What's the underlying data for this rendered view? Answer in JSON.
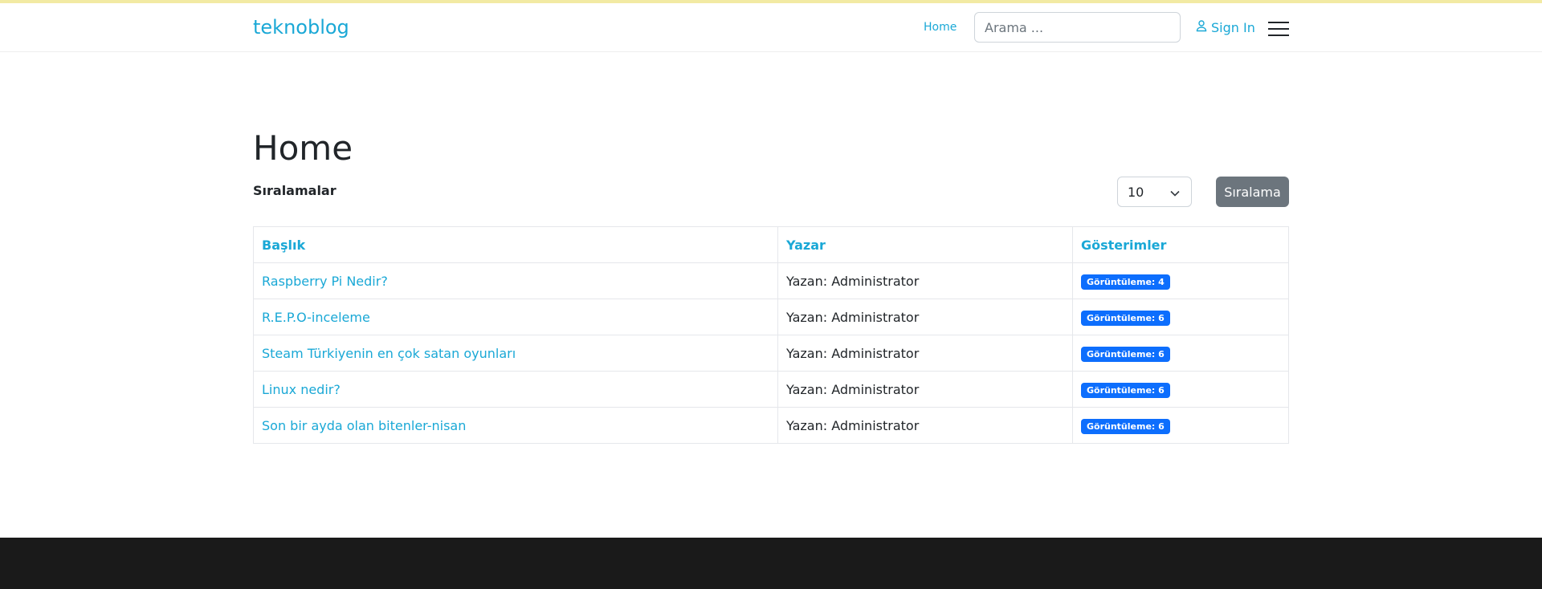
{
  "header": {
    "brand": "teknoblog",
    "nav_home": "Home",
    "search_placeholder": "Arama ...",
    "signin": "Sign In"
  },
  "main": {
    "title": "Home",
    "section_label": "Sıralamalar",
    "per_page_value": "10",
    "sort_button": "Sıralama"
  },
  "table": {
    "headers": [
      "Başlık",
      "Yazar",
      "Gösterimler"
    ],
    "rows": [
      {
        "title": "Raspberry Pi Nedir?",
        "author": "Yazan: Administrator",
        "views": "Görüntüleme: 4"
      },
      {
        "title": "R.E.P.O-inceleme",
        "author": "Yazan: Administrator",
        "views": "Görüntüleme: 6"
      },
      {
        "title": "Steam Türkiyenin en çok satan oyunları",
        "author": "Yazan: Administrator",
        "views": "Görüntüleme: 6"
      },
      {
        "title": "Linux nedir?",
        "author": "Yazan: Administrator",
        "views": "Görüntüleme: 6"
      },
      {
        "title": "Son bir ayda olan bitenler-nisan",
        "author": "Yazan: Administrator",
        "views": "Görüntüleme: 6"
      }
    ]
  },
  "colors": {
    "accent": "#1aa8d6",
    "badge": "#0d6efd",
    "footer": "#1a1a1a"
  }
}
